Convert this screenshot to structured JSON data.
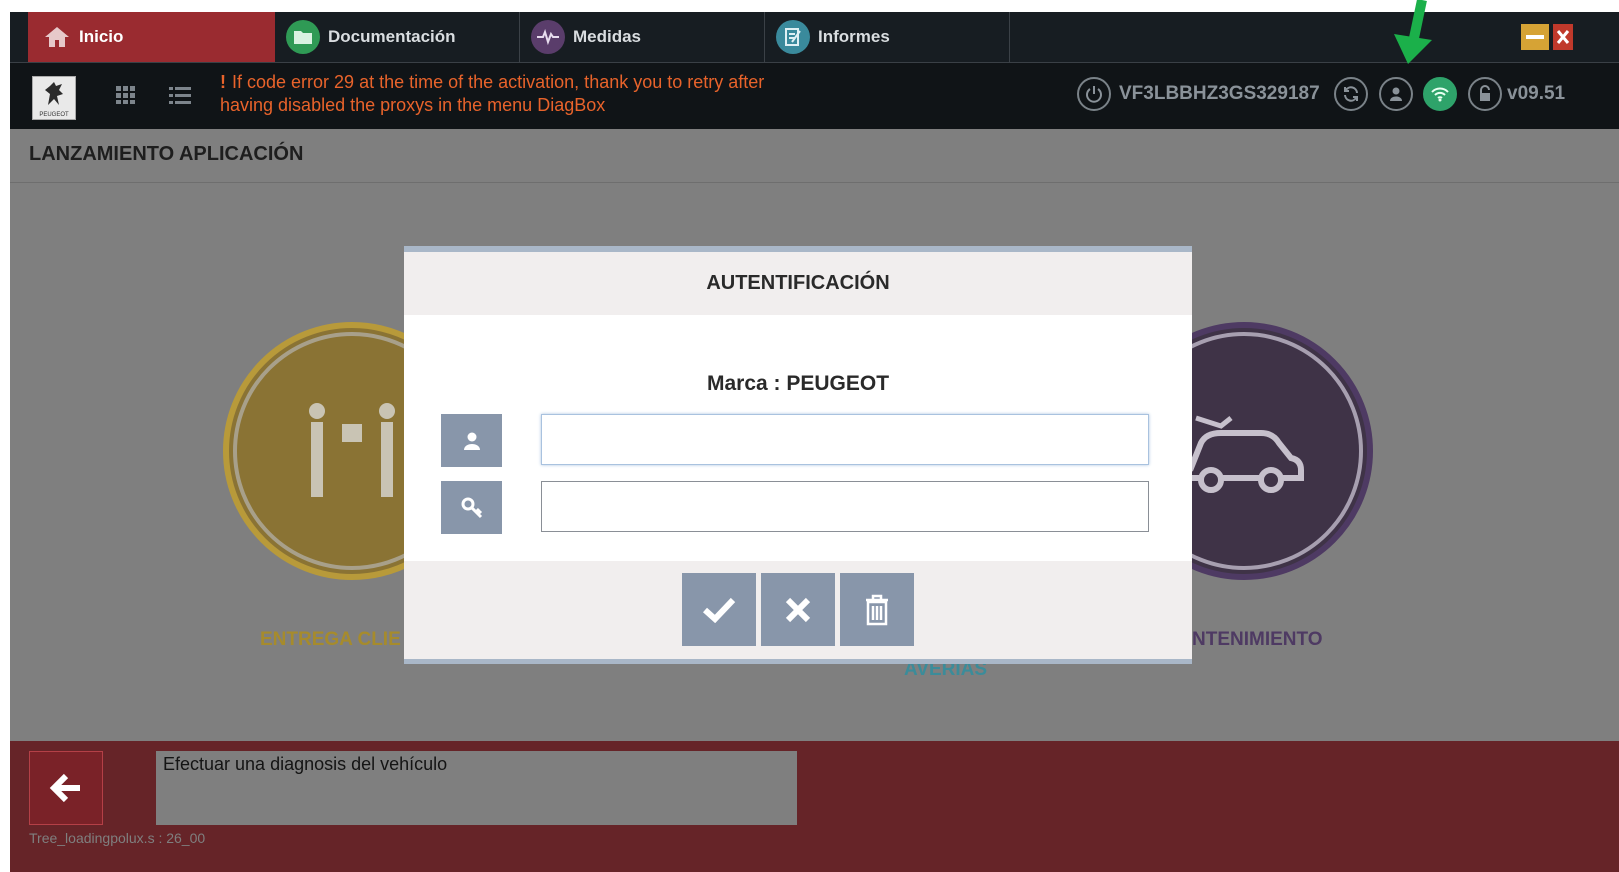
{
  "tabs": [
    {
      "label": "Inicio",
      "icon": "home-icon",
      "active": true
    },
    {
      "label": "Documentación",
      "icon": "folder-icon",
      "active": false
    },
    {
      "label": "Medidas",
      "icon": "pulse-icon",
      "active": false
    },
    {
      "label": "Informes",
      "icon": "report-icon",
      "active": false
    }
  ],
  "toolbar": {
    "logo_text": "PEUGEOT",
    "warning_line1": "If code error 29 at the time of the activation, thank you to retry after",
    "warning_line2": "having disabled the proxys in the menu DiagBox",
    "vin": "VF3LBBHZ3GS329187",
    "version": "v09.51"
  },
  "page": {
    "title": "LANZAMIENTO APLICACIÓN",
    "apps": [
      {
        "label": "ENTREGA CLIE",
        "color": "#c6a133"
      },
      {
        "label": "AVERIAS",
        "color": "#3b8c9a"
      },
      {
        "label": "NTENIMIENTO",
        "color": "#4e3a63"
      }
    ]
  },
  "dialog": {
    "title": "AUTENTIFICACIÓN",
    "brand": "Marca : PEUGEOT",
    "username_value": "",
    "password_value": ""
  },
  "bottom": {
    "message": "Efectuar una diagnosis del vehículo",
    "status": "Tree_loadingpolux.s : 26_00"
  },
  "colors": {
    "active_tab": "#9a2b30",
    "bottom_bar": "#662428",
    "warning_text": "#e8632b",
    "dialog_button": "#8896aa",
    "wifi_active": "#2ea36a",
    "annotation_arrow": "#1bb04a"
  }
}
